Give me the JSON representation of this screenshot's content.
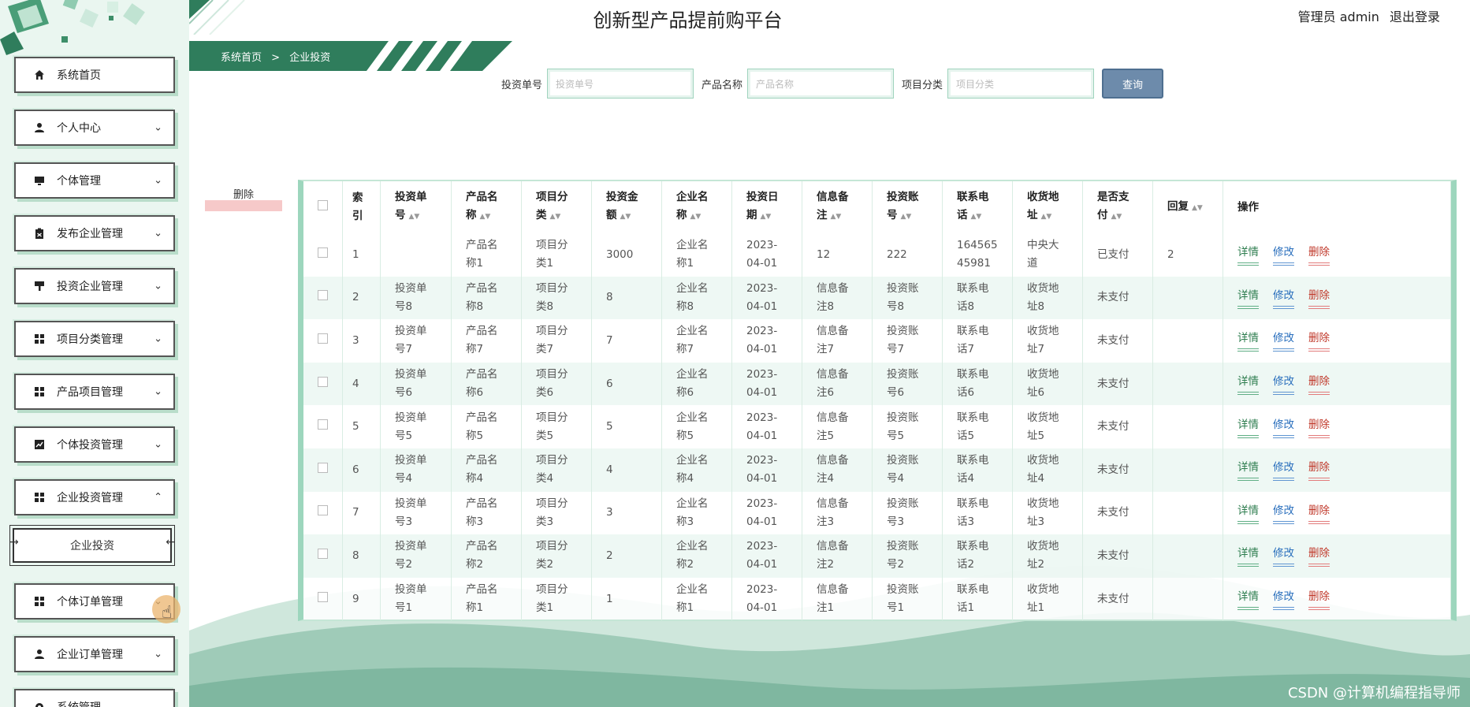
{
  "header": {
    "title": "创新型产品提前购平台",
    "user_label": "管理员 admin",
    "logout_label": "退出登录"
  },
  "sidebar": {
    "items": [
      {
        "label": "系统首页",
        "icon": "home-icon",
        "expanded": null
      },
      {
        "label": "个人中心",
        "icon": "user-icon",
        "expanded": false
      },
      {
        "label": "个体管理",
        "icon": "monitor-icon",
        "expanded": false
      },
      {
        "label": "发布企业管理",
        "icon": "clipboard-icon",
        "expanded": false
      },
      {
        "label": "投资企业管理",
        "icon": "paint-roller-icon",
        "expanded": false
      },
      {
        "label": "项目分类管理",
        "icon": "grid-icon",
        "expanded": false
      },
      {
        "label": "产品项目管理",
        "icon": "grid-icon",
        "expanded": false
      },
      {
        "label": "个体投资管理",
        "icon": "chart-icon",
        "expanded": false
      },
      {
        "label": "企业投资管理",
        "icon": "grid-icon",
        "expanded": true
      },
      {
        "label": "个体订单管理",
        "icon": "grid-icon",
        "expanded": false
      },
      {
        "label": "企业订单管理",
        "icon": "user-icon",
        "expanded": false
      },
      {
        "label": "系统管理",
        "icon": "gear-icon",
        "expanded": false
      }
    ],
    "sub_item": "企业投资"
  },
  "breadcrumb": {
    "home": "系统首页",
    "separator": ">",
    "current": "企业投资"
  },
  "search": {
    "fields": [
      {
        "label": "投资单号",
        "placeholder": "投资单号"
      },
      {
        "label": "产品名称",
        "placeholder": "产品名称"
      },
      {
        "label": "项目分类",
        "placeholder": "项目分类"
      }
    ],
    "button": "查询"
  },
  "actions": {
    "delete": "删除"
  },
  "table": {
    "columns": [
      "索引",
      "投资单号",
      "产品名称",
      "项目分类",
      "投资金额",
      "企业名称",
      "投资日期",
      "信息备注",
      "投资账号",
      "联系电话",
      "收货地址",
      "是否支付",
      "回复",
      "操作"
    ],
    "rows": [
      {
        "idx": "1",
        "no": "",
        "product": "产品名称1",
        "category": "项目分类1",
        "amount": "3000",
        "company": "企业名称1",
        "date": "2023-04-01",
        "note": "12",
        "account": "222",
        "phone": "16456545981",
        "address": "中央大道",
        "paid": "已支付",
        "reply": "2"
      },
      {
        "idx": "2",
        "no": "投资单号8",
        "product": "产品名称8",
        "category": "项目分类8",
        "amount": "8",
        "company": "企业名称8",
        "date": "2023-04-01",
        "note": "信息备注8",
        "account": "投资账号8",
        "phone": "联系电话8",
        "address": "收货地址8",
        "paid": "未支付",
        "reply": ""
      },
      {
        "idx": "3",
        "no": "投资单号7",
        "product": "产品名称7",
        "category": "项目分类7",
        "amount": "7",
        "company": "企业名称7",
        "date": "2023-04-01",
        "note": "信息备注7",
        "account": "投资账号7",
        "phone": "联系电话7",
        "address": "收货地址7",
        "paid": "未支付",
        "reply": ""
      },
      {
        "idx": "4",
        "no": "投资单号6",
        "product": "产品名称6",
        "category": "项目分类6",
        "amount": "6",
        "company": "企业名称6",
        "date": "2023-04-01",
        "note": "信息备注6",
        "account": "投资账号6",
        "phone": "联系电话6",
        "address": "收货地址6",
        "paid": "未支付",
        "reply": ""
      },
      {
        "idx": "5",
        "no": "投资单号5",
        "product": "产品名称5",
        "category": "项目分类5",
        "amount": "5",
        "company": "企业名称5",
        "date": "2023-04-01",
        "note": "信息备注5",
        "account": "投资账号5",
        "phone": "联系电话5",
        "address": "收货地址5",
        "paid": "未支付",
        "reply": ""
      },
      {
        "idx": "6",
        "no": "投资单号4",
        "product": "产品名称4",
        "category": "项目分类4",
        "amount": "4",
        "company": "企业名称4",
        "date": "2023-04-01",
        "note": "信息备注4",
        "account": "投资账号4",
        "phone": "联系电话4",
        "address": "收货地址4",
        "paid": "未支付",
        "reply": ""
      },
      {
        "idx": "7",
        "no": "投资单号3",
        "product": "产品名称3",
        "category": "项目分类3",
        "amount": "3",
        "company": "企业名称3",
        "date": "2023-04-01",
        "note": "信息备注3",
        "account": "投资账号3",
        "phone": "联系电话3",
        "address": "收货地址3",
        "paid": "未支付",
        "reply": ""
      },
      {
        "idx": "8",
        "no": "投资单号2",
        "product": "产品名称2",
        "category": "项目分类2",
        "amount": "2",
        "company": "企业名称2",
        "date": "2023-04-01",
        "note": "信息备注2",
        "account": "投资账号2",
        "phone": "联系电话2",
        "address": "收货地址2",
        "paid": "未支付",
        "reply": ""
      },
      {
        "idx": "9",
        "no": "投资单号1",
        "product": "产品名称1",
        "category": "项目分类1",
        "amount": "1",
        "company": "企业名称1",
        "date": "2023-04-01",
        "note": "信息备注1",
        "account": "投资账号1",
        "phone": "联系电话1",
        "address": "收货地址1",
        "paid": "未支付",
        "reply": ""
      }
    ],
    "row_actions": {
      "detail": "详情",
      "edit": "修改",
      "delete": "删除"
    }
  },
  "watermark": "CSDN @计算机编程指导师",
  "colors": {
    "accent": "#2f7d5c",
    "sidebar_bg": "#eaf6f0",
    "search_button": "#6d8bab",
    "detail": "#2e7d4f",
    "edit": "#2a6fbd",
    "delete": "#c0392b"
  }
}
